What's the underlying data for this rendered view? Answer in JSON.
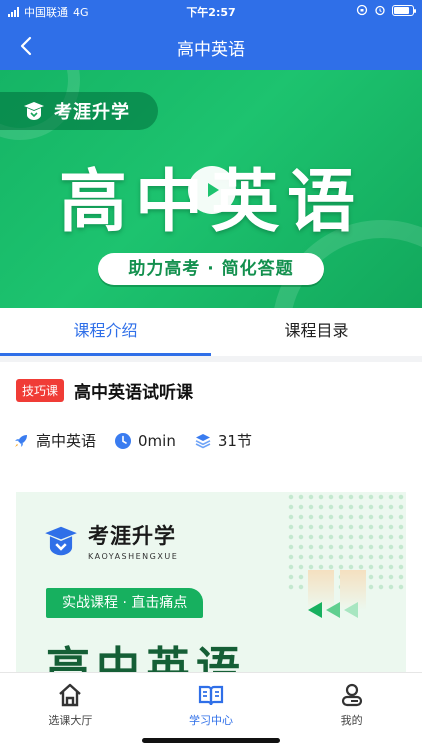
{
  "status_bar": {
    "carrier": "中国联通",
    "network": "4G",
    "time": "下午2:57"
  },
  "nav": {
    "title": "高中英语",
    "back_icon": "chevron-left-icon"
  },
  "banner": {
    "brand": "考涯升学",
    "title": "高中英语",
    "slogan": "助力高考 · 简化答题",
    "colors": {
      "green": "#1dc36f",
      "slogan_text": "#13904e"
    }
  },
  "tabs": [
    {
      "label": "课程介绍",
      "active": true
    },
    {
      "label": "课程目录",
      "active": false
    }
  ],
  "course": {
    "tag": "技巧课",
    "title": "高中英语试听课",
    "meta": {
      "subject": "高中英语",
      "duration": "0min",
      "lessons": "31节"
    }
  },
  "poster": {
    "brand": "考涯升学",
    "brand_sub": "KAOYASHENGXUE",
    "slogan": "实战课程 · 直击痛点",
    "title": "高中英语"
  },
  "tabbar": [
    {
      "label": "选课大厅",
      "icon": "home-icon",
      "active": false
    },
    {
      "label": "学习中心",
      "icon": "book-icon",
      "active": true
    },
    {
      "label": "我的",
      "icon": "user-icon",
      "active": false
    }
  ],
  "colors": {
    "primary": "#2f6fe8",
    "tag_red": "#f03c36"
  }
}
